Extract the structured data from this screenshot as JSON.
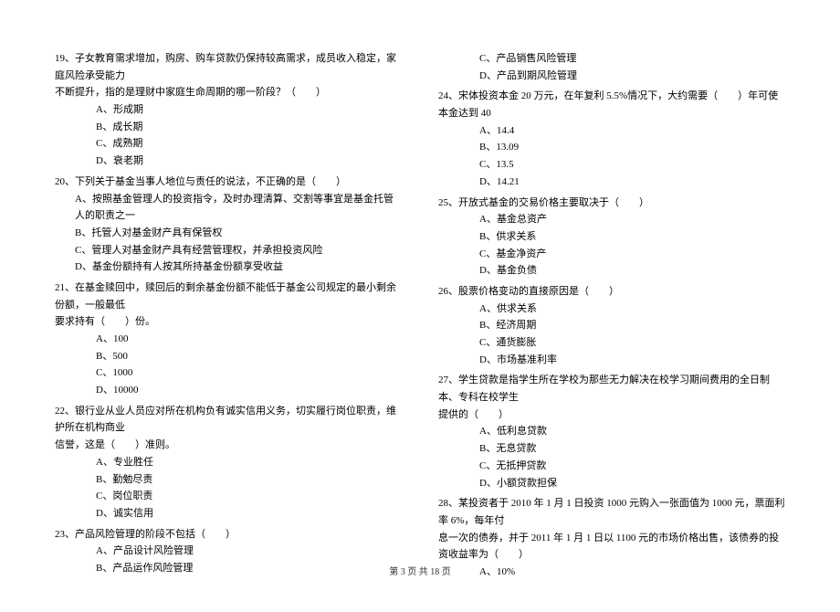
{
  "left": {
    "q19": {
      "line1": "19、子女教育需求增加，购房、购车贷款仍保持较高需求，成员收入稳定，家庭风险承受能力",
      "line2": "不断提升，指的是理财中家庭生命周期的哪一阶段？（　　）",
      "a": "A、形成期",
      "b": "B、成长期",
      "c": "C、成熟期",
      "d": "D、衰老期"
    },
    "q20": {
      "text": "20、下列关于基金当事人地位与责任的说法，不正确的是（　　）",
      "a": "A、按照基金管理人的投资指令，及时办理清算、交割等事宜是基金托管人的职责之一",
      "b": "B、托管人对基金财产具有保管权",
      "c": "C、管理人对基金财产具有经营管理权，并承担投资风险",
      "d": "D、基金份额持有人按其所持基金份额享受收益"
    },
    "q21": {
      "line1": "21、在基金赎回中，赎回后的剩余基金份额不能低于基金公司规定的最小剩余份额，一般最低",
      "line2": "要求持有（　　）份。",
      "a": "A、100",
      "b": "B、500",
      "c": "C、1000",
      "d": "D、10000"
    },
    "q22": {
      "line1": "22、银行业从业人员应对所在机构负有诚实信用义务，切实履行岗位职责，维护所在机构商业",
      "line2": "信誉，这是（　　）准则。",
      "a": "A、专业胜任",
      "b": "B、勤勉尽责",
      "c": "C、岗位职责",
      "d": "D、诚实信用"
    },
    "q23": {
      "text": "23、产品风险管理的阶段不包括（　　）",
      "a": "A、产品设计风险管理",
      "b": "B、产品运作风险管理"
    }
  },
  "right": {
    "q23cont": {
      "c": "C、产品销售风险管理",
      "d": "D、产品到期风险管理"
    },
    "q24": {
      "text": "24、宋体投资本金 20 万元，在年复利 5.5%情况下，大约需要（　　）年可使本金达到 40",
      "a": "A、14.4",
      "b": "B、13.09",
      "c": "C、13.5",
      "d": "D、14.21"
    },
    "q25": {
      "text": "25、开放式基金的交易价格主要取决于（　　）",
      "a": "A、基金总资产",
      "b": "B、供求关系",
      "c": "C、基金净资产",
      "d": "D、基金负债"
    },
    "q26": {
      "text": "26、股票价格变动的直接原因是（　　）",
      "a": "A、供求关系",
      "b": "B、经济周期",
      "c": "C、通货膨胀",
      "d": "D、市场基准利率"
    },
    "q27": {
      "line1": "27、学生贷款是指学生所在学校为那些无力解决在校学习期间费用的全日制本、专科在校学生",
      "line2": "提供的（　　）",
      "a": "A、低利息贷款",
      "b": "B、无息贷款",
      "c": "C、无抵押贷款",
      "d": "D、小额贷款担保"
    },
    "q28": {
      "line1": "28、某投资者于 2010 年 1 月 1 日投资 1000 元购入一张面值为 1000 元，票面利率 6%，每年付",
      "line2": "息一次的债券，并于 2011 年 1 月 1 日以 1100 元的市场价格出售，该债券的投资收益率为（　　）",
      "a": "A、10%"
    }
  },
  "footer": "第 3 页 共 18 页"
}
